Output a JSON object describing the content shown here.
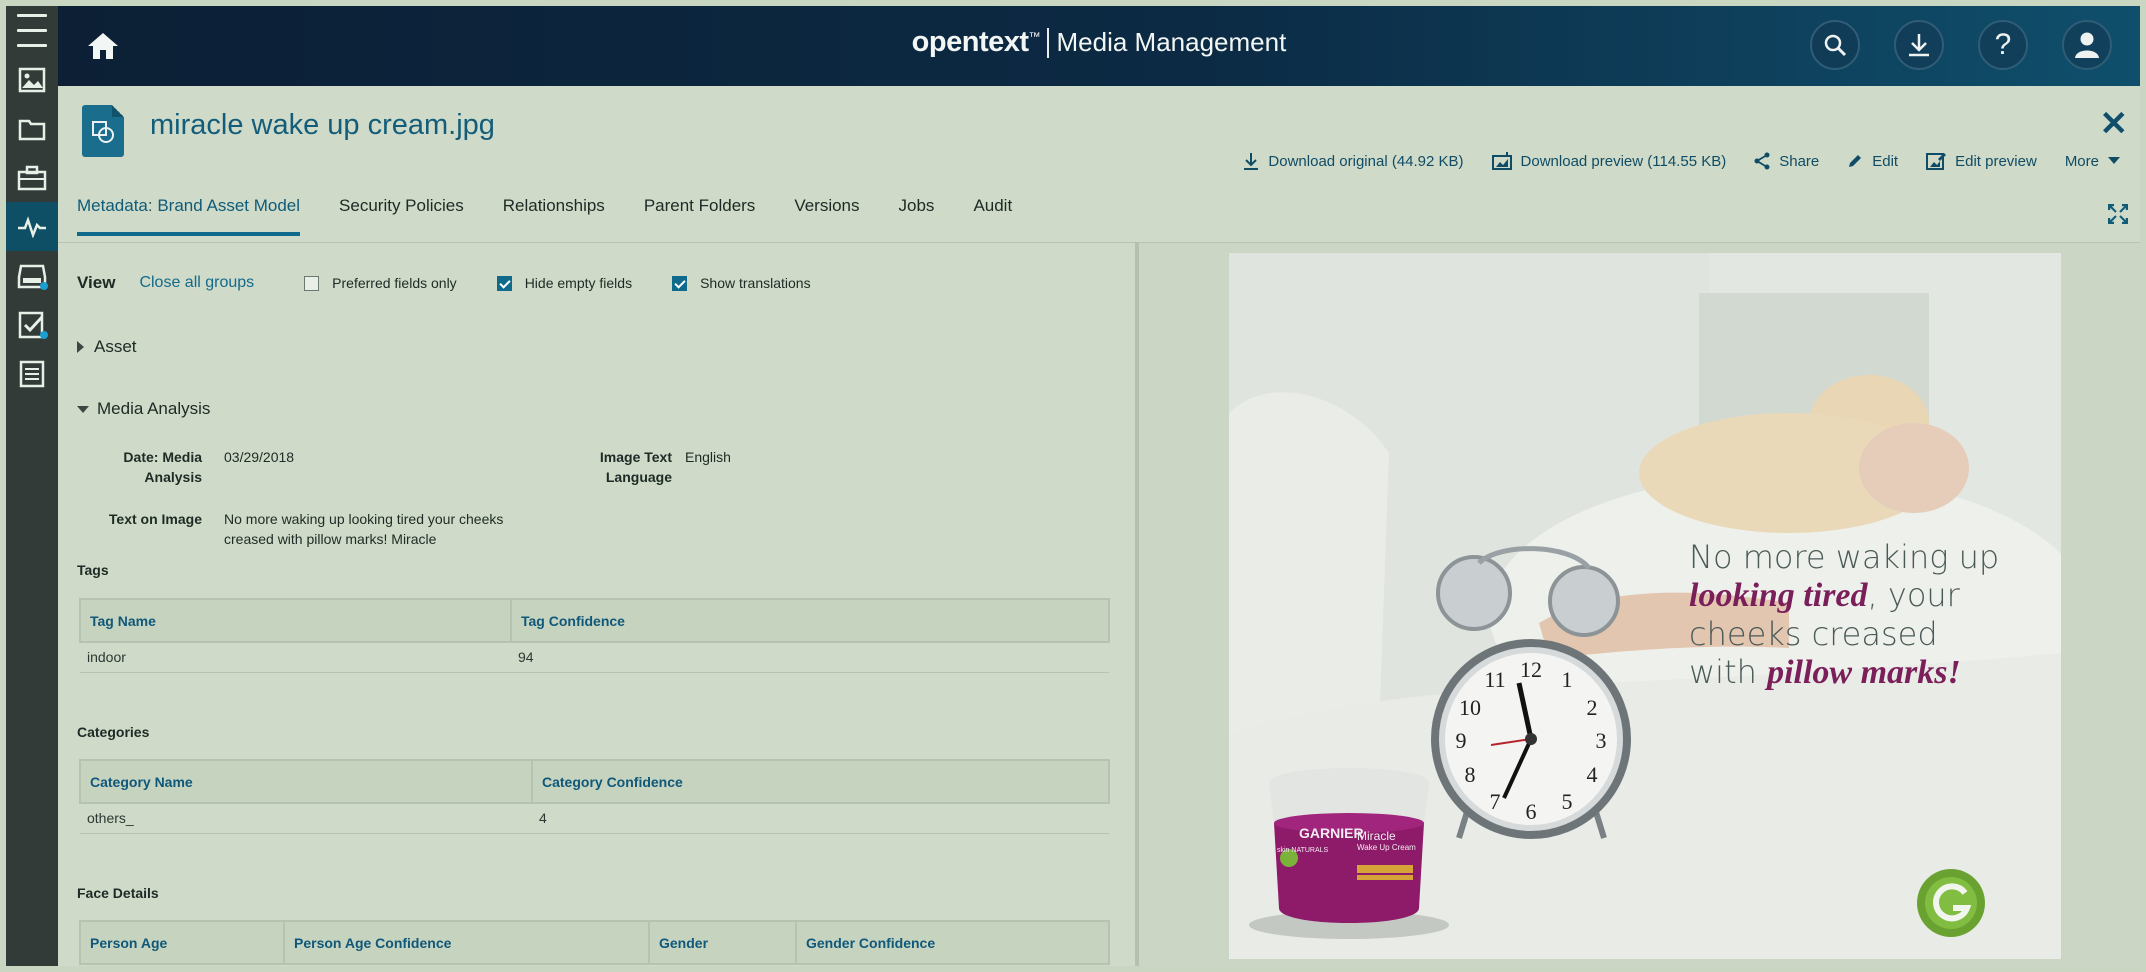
{
  "topbar": {
    "brand_logo": "opentext",
    "brand_tm": "™",
    "product": "Media Management",
    "icons": [
      "home-icon",
      "search-icon",
      "download-icon",
      "help-icon",
      "user-icon"
    ]
  },
  "rail": {
    "icons": [
      "menu-icon",
      "images-icon",
      "folder-icon",
      "briefcase-icon",
      "activity-icon",
      "inbox-icon",
      "tasks-icon",
      "list-icon"
    ]
  },
  "asset": {
    "title": "miracle wake up cream.jpg"
  },
  "actions": {
    "download_original": "Download original (44.92 KB)",
    "download_preview": "Download preview (114.55 KB)",
    "share": "Share",
    "edit": "Edit",
    "edit_preview": "Edit preview",
    "more": "More"
  },
  "tabs": [
    {
      "label": "Metadata: Brand Asset Model"
    },
    {
      "label": "Security Policies"
    },
    {
      "label": "Relationships"
    },
    {
      "label": "Parent Folders"
    },
    {
      "label": "Versions"
    },
    {
      "label": "Jobs"
    },
    {
      "label": "Audit"
    }
  ],
  "viewbar": {
    "view": "View",
    "close_all": "Close all groups",
    "preferred": "Preferred fields only",
    "hide_empty": "Hide empty fields",
    "show_translations": "Show translations",
    "preferred_checked": false,
    "hide_empty_checked": true,
    "show_translations_checked": true
  },
  "groups": {
    "asset": "Asset",
    "media_analysis": "Media Analysis"
  },
  "fields": {
    "date_label_1": "Date: Media",
    "date_label_2": "Analysis",
    "date_value": "03/29/2018",
    "lang_label_1": "Image Text",
    "lang_label_2": "Language",
    "lang_value": "English",
    "text_label": "Text on Image",
    "text_value_1": "No more waking up looking tired your cheeks",
    "text_value_2": "creased with pillow marks! Miracle"
  },
  "tags": {
    "title": "Tags",
    "headers": [
      "Tag Name",
      "Tag Confidence"
    ],
    "rows": [
      [
        "indoor",
        "94"
      ]
    ]
  },
  "categories": {
    "title": "Categories",
    "headers": [
      "Category Name",
      "Category Confidence"
    ],
    "rows": [
      [
        "others_",
        "4"
      ]
    ]
  },
  "faces": {
    "title": "Face Details",
    "headers": [
      "Person Age",
      "Person Age Confidence",
      "Gender",
      "Gender Confidence"
    ]
  },
  "preview": {
    "line1": "No more waking up",
    "line2a": "looking tired",
    "line2b": ", your",
    "line3": "cheeks creased",
    "line4a": "with ",
    "line4b": "pillow marks!",
    "jar_brand": "GARNIER",
    "jar_sub": "skin NATURALS",
    "jar_product": "Miracle",
    "jar_product_2": "Wake Up Cream"
  }
}
